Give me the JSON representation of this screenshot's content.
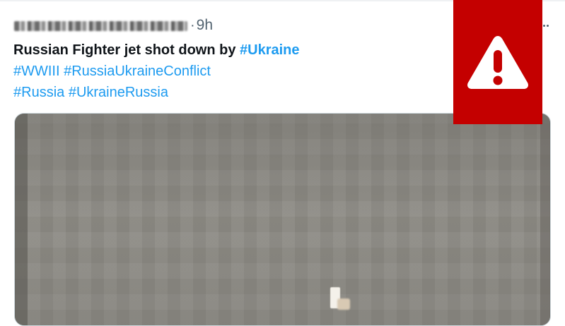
{
  "tweet": {
    "time": "9h",
    "separator": "·",
    "text_plain": "Russian Fighter jet shot down by",
    "text_hashtag": "#Ukraine",
    "hashtags_line2": [
      "#WWIII",
      "#RussiaUkraineConflict"
    ],
    "hashtags_line3": [
      "#Russia",
      "#UkraineRussia"
    ]
  },
  "icons": {
    "more": "more-options-icon",
    "warning": "warning-icon"
  },
  "colors": {
    "hashtag": "#1d9bf0",
    "text": "#0f1419",
    "muted": "#536471",
    "warning_bg": "#c40000"
  }
}
